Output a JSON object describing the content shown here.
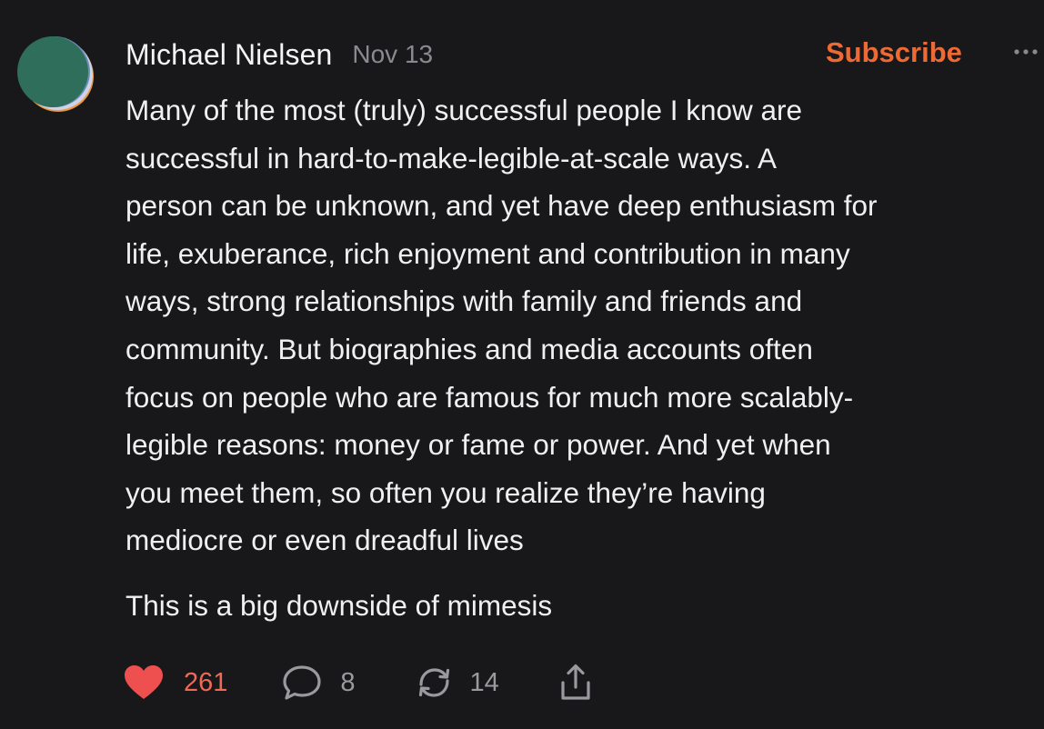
{
  "post": {
    "author": "Michael Nielsen",
    "date": "Nov 13",
    "subscribe_label": "Subscribe",
    "more_icon": "more-horizontal-icon",
    "paragraphs": [
      "Many of the most (truly) successful people I know are\nsuccessful in hard-to-make-legible-at-scale ways. A\nperson can be unknown, and yet have deep enthusiasm for\nlife, exuberance, rich enjoyment and contribution in many\nways, strong relationships with family and friends and\ncommunity. But biographies and media accounts often\nfocus on people who are famous for much more scalably-\nlegible reasons: money or fame or power. And yet when\nyou meet them, so often you realize they’re having\nmediocre or even dreadful lives",
      "This is a big downside of mimesis"
    ]
  },
  "actions": {
    "likes": "261",
    "comments": "8",
    "restacks": "14",
    "like_icon": "heart-icon",
    "comment_icon": "comment-bubble-icon",
    "restack_icon": "restack-arrows-icon",
    "share_icon": "share-icon"
  },
  "colors": {
    "background": "#18181a",
    "accent": "#ee6a35",
    "like": "#ee4f4f",
    "muted": "#9a9a9e"
  }
}
